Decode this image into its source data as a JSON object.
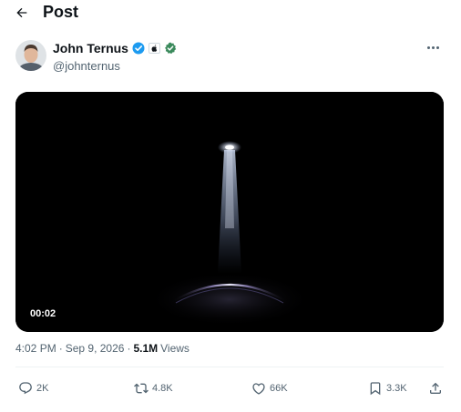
{
  "header": {
    "title": "Post"
  },
  "author": {
    "name": "John Ternus",
    "handle": "@johnternus"
  },
  "media": {
    "timestamp": "00:02"
  },
  "meta": {
    "time": "4:02 PM",
    "separator1": "·",
    "date": "Sep 9, 2026",
    "separator2": "·",
    "views_count": "5.1M",
    "views_label": "Views"
  },
  "actions": {
    "replies": "2K",
    "reposts": "4.8K",
    "likes": "66K",
    "bookmarks": "3.3K"
  },
  "colors": {
    "verified": "#1d9bf0",
    "gov_badge": "#3b8a5c",
    "text_secondary": "#536471"
  }
}
